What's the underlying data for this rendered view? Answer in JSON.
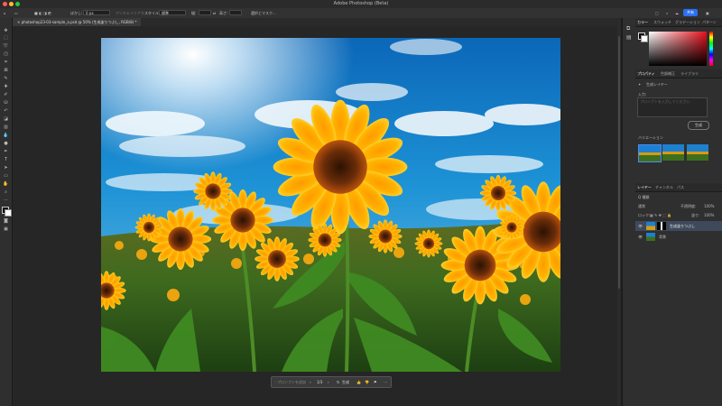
{
  "app": {
    "title": "Adobe Photoshop (Beta)"
  },
  "options_bar": {
    "size_label": "ぼかし:",
    "size_value": "0 px",
    "antialias_label": "アンチエイリアス",
    "style_label": "スタイル:",
    "style_value": "標準",
    "width_label": "幅:",
    "height_label": "高さ:",
    "select_mask_button": "選択とマスク...",
    "share_button": "共有"
  },
  "document": {
    "tab_title": "photoshop23-03-sample_a.psd @ 50% (生成塗りつぶし, RGB/8) *"
  },
  "context_bar": {
    "prompt_placeholder": "プロンプトを追加",
    "counter": "1/3",
    "generate_label": "生成"
  },
  "color_panel": {
    "tabs": [
      "カラー",
      "スウォッチ",
      "グラデーション",
      "パターン"
    ]
  },
  "properties_panel": {
    "tabs": [
      "プロパティ",
      "色調補正",
      "ライブラリ"
    ],
    "layer_type": "生成レイヤー",
    "prompt_label": "入力:",
    "prompt_placeholder": "プロンプトを入力してください",
    "generate_button": "生成",
    "variations_label": "バリエーション"
  },
  "layers_panel": {
    "tabs": [
      "レイヤー",
      "チャンネル",
      "パス"
    ],
    "filter_label": "Q 種類",
    "blend_mode": "通常",
    "opacity_label": "不透明度:",
    "opacity_value": "100%",
    "lock_label": "ロック:",
    "fill_label": "塗り:",
    "fill_value": "100%",
    "layers": [
      {
        "name": "生成塗りつぶし",
        "selected": true
      },
      {
        "name": "背景",
        "selected": false
      }
    ]
  },
  "colors": {
    "accent": "#2b6ff2",
    "panel_bg": "#2f2f2f",
    "canvas_bg": "#262626"
  }
}
